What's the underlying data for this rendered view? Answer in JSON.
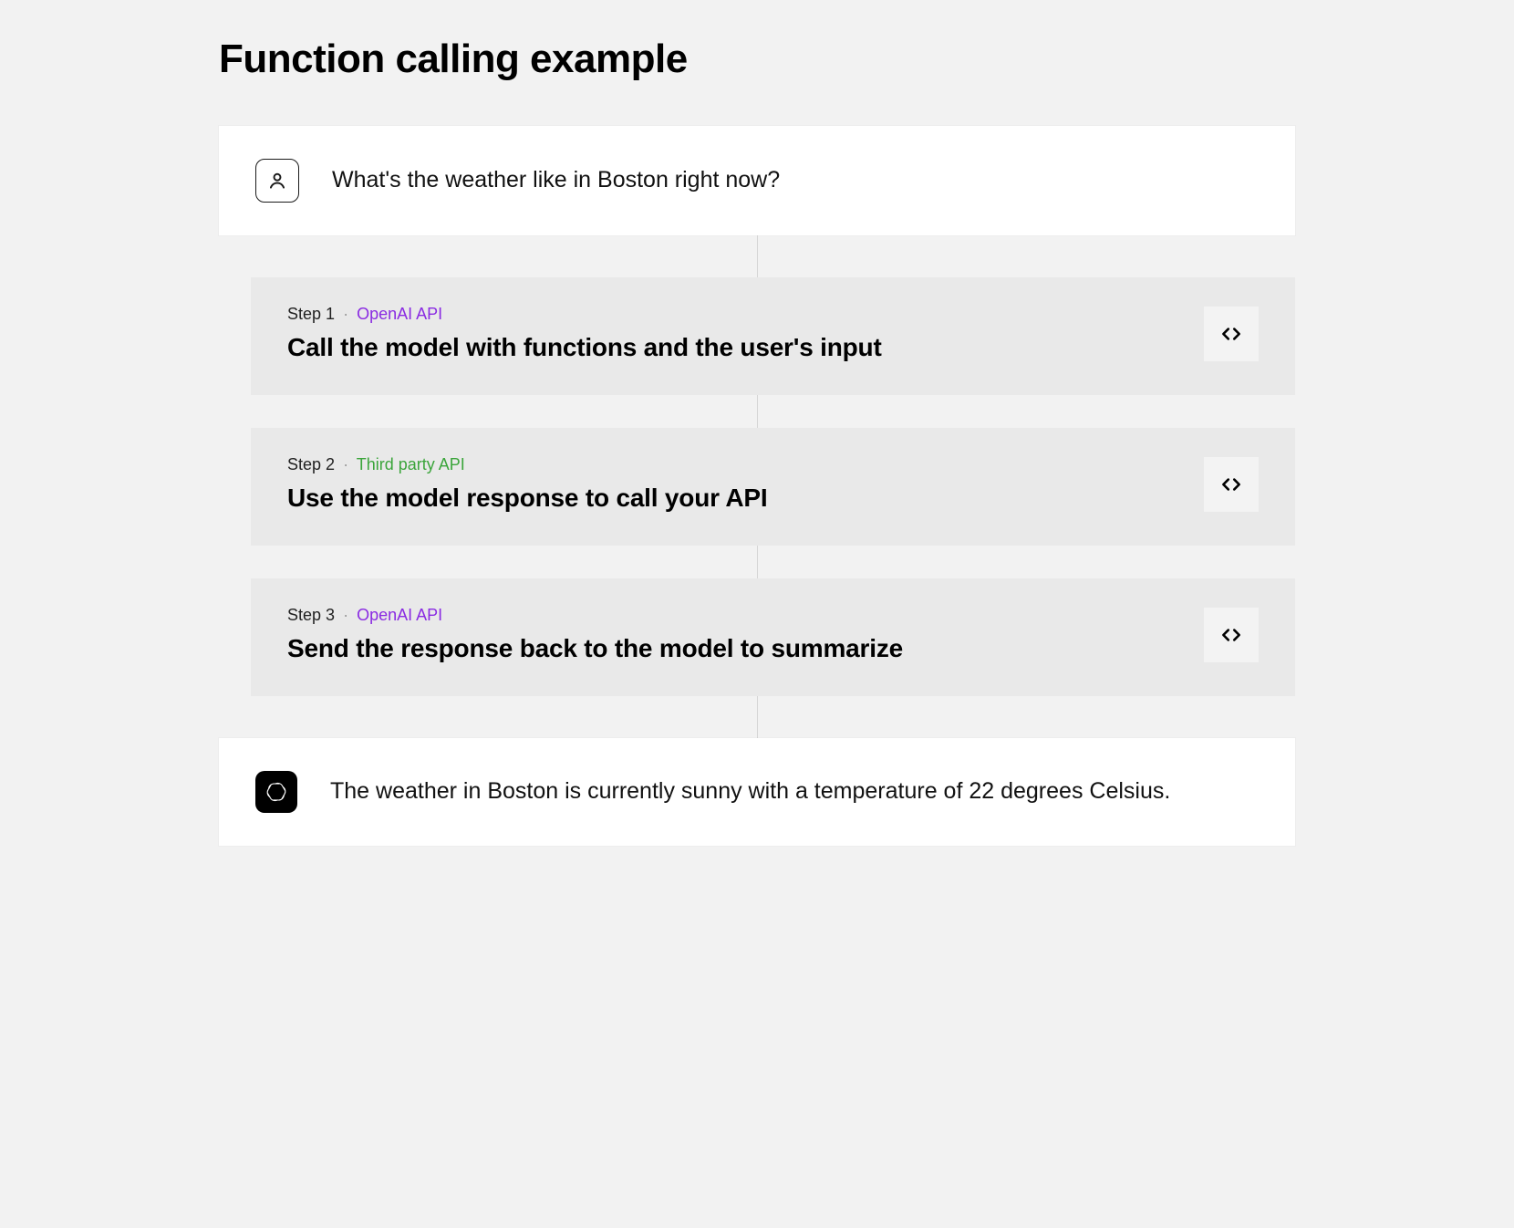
{
  "title": "Function calling example",
  "user_message": "What's the weather like in Boston right now?",
  "ai_message": "The weather in Boston is currently sunny with a temperature of 22 degrees Celsius.",
  "steps": [
    {
      "label": "Step 1",
      "tag": "OpenAI API",
      "tag_color": "purple",
      "title": "Call the model with functions and the user's input"
    },
    {
      "label": "Step 2",
      "tag": "Third party API",
      "tag_color": "green",
      "title": "Use the model response to call your API"
    },
    {
      "label": "Step 3",
      "tag": "OpenAI API",
      "tag_color": "purple",
      "title": "Send the response back to the model to summarize"
    }
  ]
}
